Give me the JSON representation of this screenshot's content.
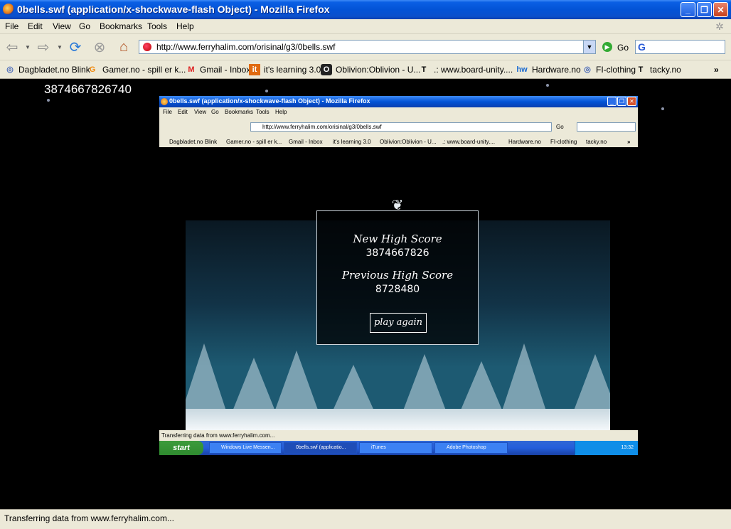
{
  "window": {
    "title": "0bells.swf (application/x-shockwave-flash Object) - Mozilla Firefox",
    "minimize": "_",
    "maximize": "❐",
    "close": "✕"
  },
  "menu": [
    "File",
    "Edit",
    "View",
    "Go",
    "Bookmarks",
    "Tools",
    "Help"
  ],
  "nav": {
    "url": "http://www.ferryhalim.com/orisinal/g3/0bells.swf",
    "go_label": "Go",
    "search_placeholder": ""
  },
  "bookmarks": [
    {
      "label": "Dagbladet.no Blink",
      "icon": "globe-icon"
    },
    {
      "label": "Gamer.no - spill er k...",
      "icon": "gamer-icon"
    },
    {
      "label": "Gmail - Inbox",
      "icon": "gmail-icon"
    },
    {
      "label": "it's learning 3.0",
      "icon": "itslearning-icon"
    },
    {
      "label": "Oblivion:Oblivion - U...",
      "icon": "oblivion-icon"
    },
    {
      "label": ".: www.board-unity....",
      "icon": "tacky-icon"
    },
    {
      "label": "Hardware.no",
      "icon": "hw-icon"
    },
    {
      "label": "FI-clothing",
      "icon": "globe-icon"
    },
    {
      "label": "tacky.no",
      "icon": "tacky-icon"
    }
  ],
  "bookmarks_more": "»",
  "content": {
    "top_score": "3874667826740"
  },
  "inner": {
    "title": "0bells.swf (application/x-shockwave-flash Object) - Mozilla Firefox",
    "url": "http://www.ferryhalim.com/orisinal/g3/0bells.swf",
    "go_label": "Go",
    "bookmarks": [
      "Dagbladet.no Blink",
      "Gamer.no - spill er k...",
      "Gmail - Inbox",
      "it's learning 3.0",
      "Oblivion:Oblivion - U...",
      ".: www.board-unity....",
      "Hardware.no",
      "FI-clothing",
      "tacky.no"
    ],
    "status": "Transferring data from www.ferryhalim.com...",
    "start": "start",
    "tasks": [
      "Windows Live Messen...",
      "0bells.swf (applicatio...",
      "iTunes",
      "Adobe Photoshop"
    ],
    "clock": "13:32"
  },
  "game": {
    "new_high_label": "New High Score",
    "new_high_value": "3874667826",
    "prev_high_label": "Previous High Score",
    "prev_high_value": "8728480",
    "play_again": "play again"
  },
  "status": {
    "text": "Transferring data from www.ferryhalim.com..."
  }
}
